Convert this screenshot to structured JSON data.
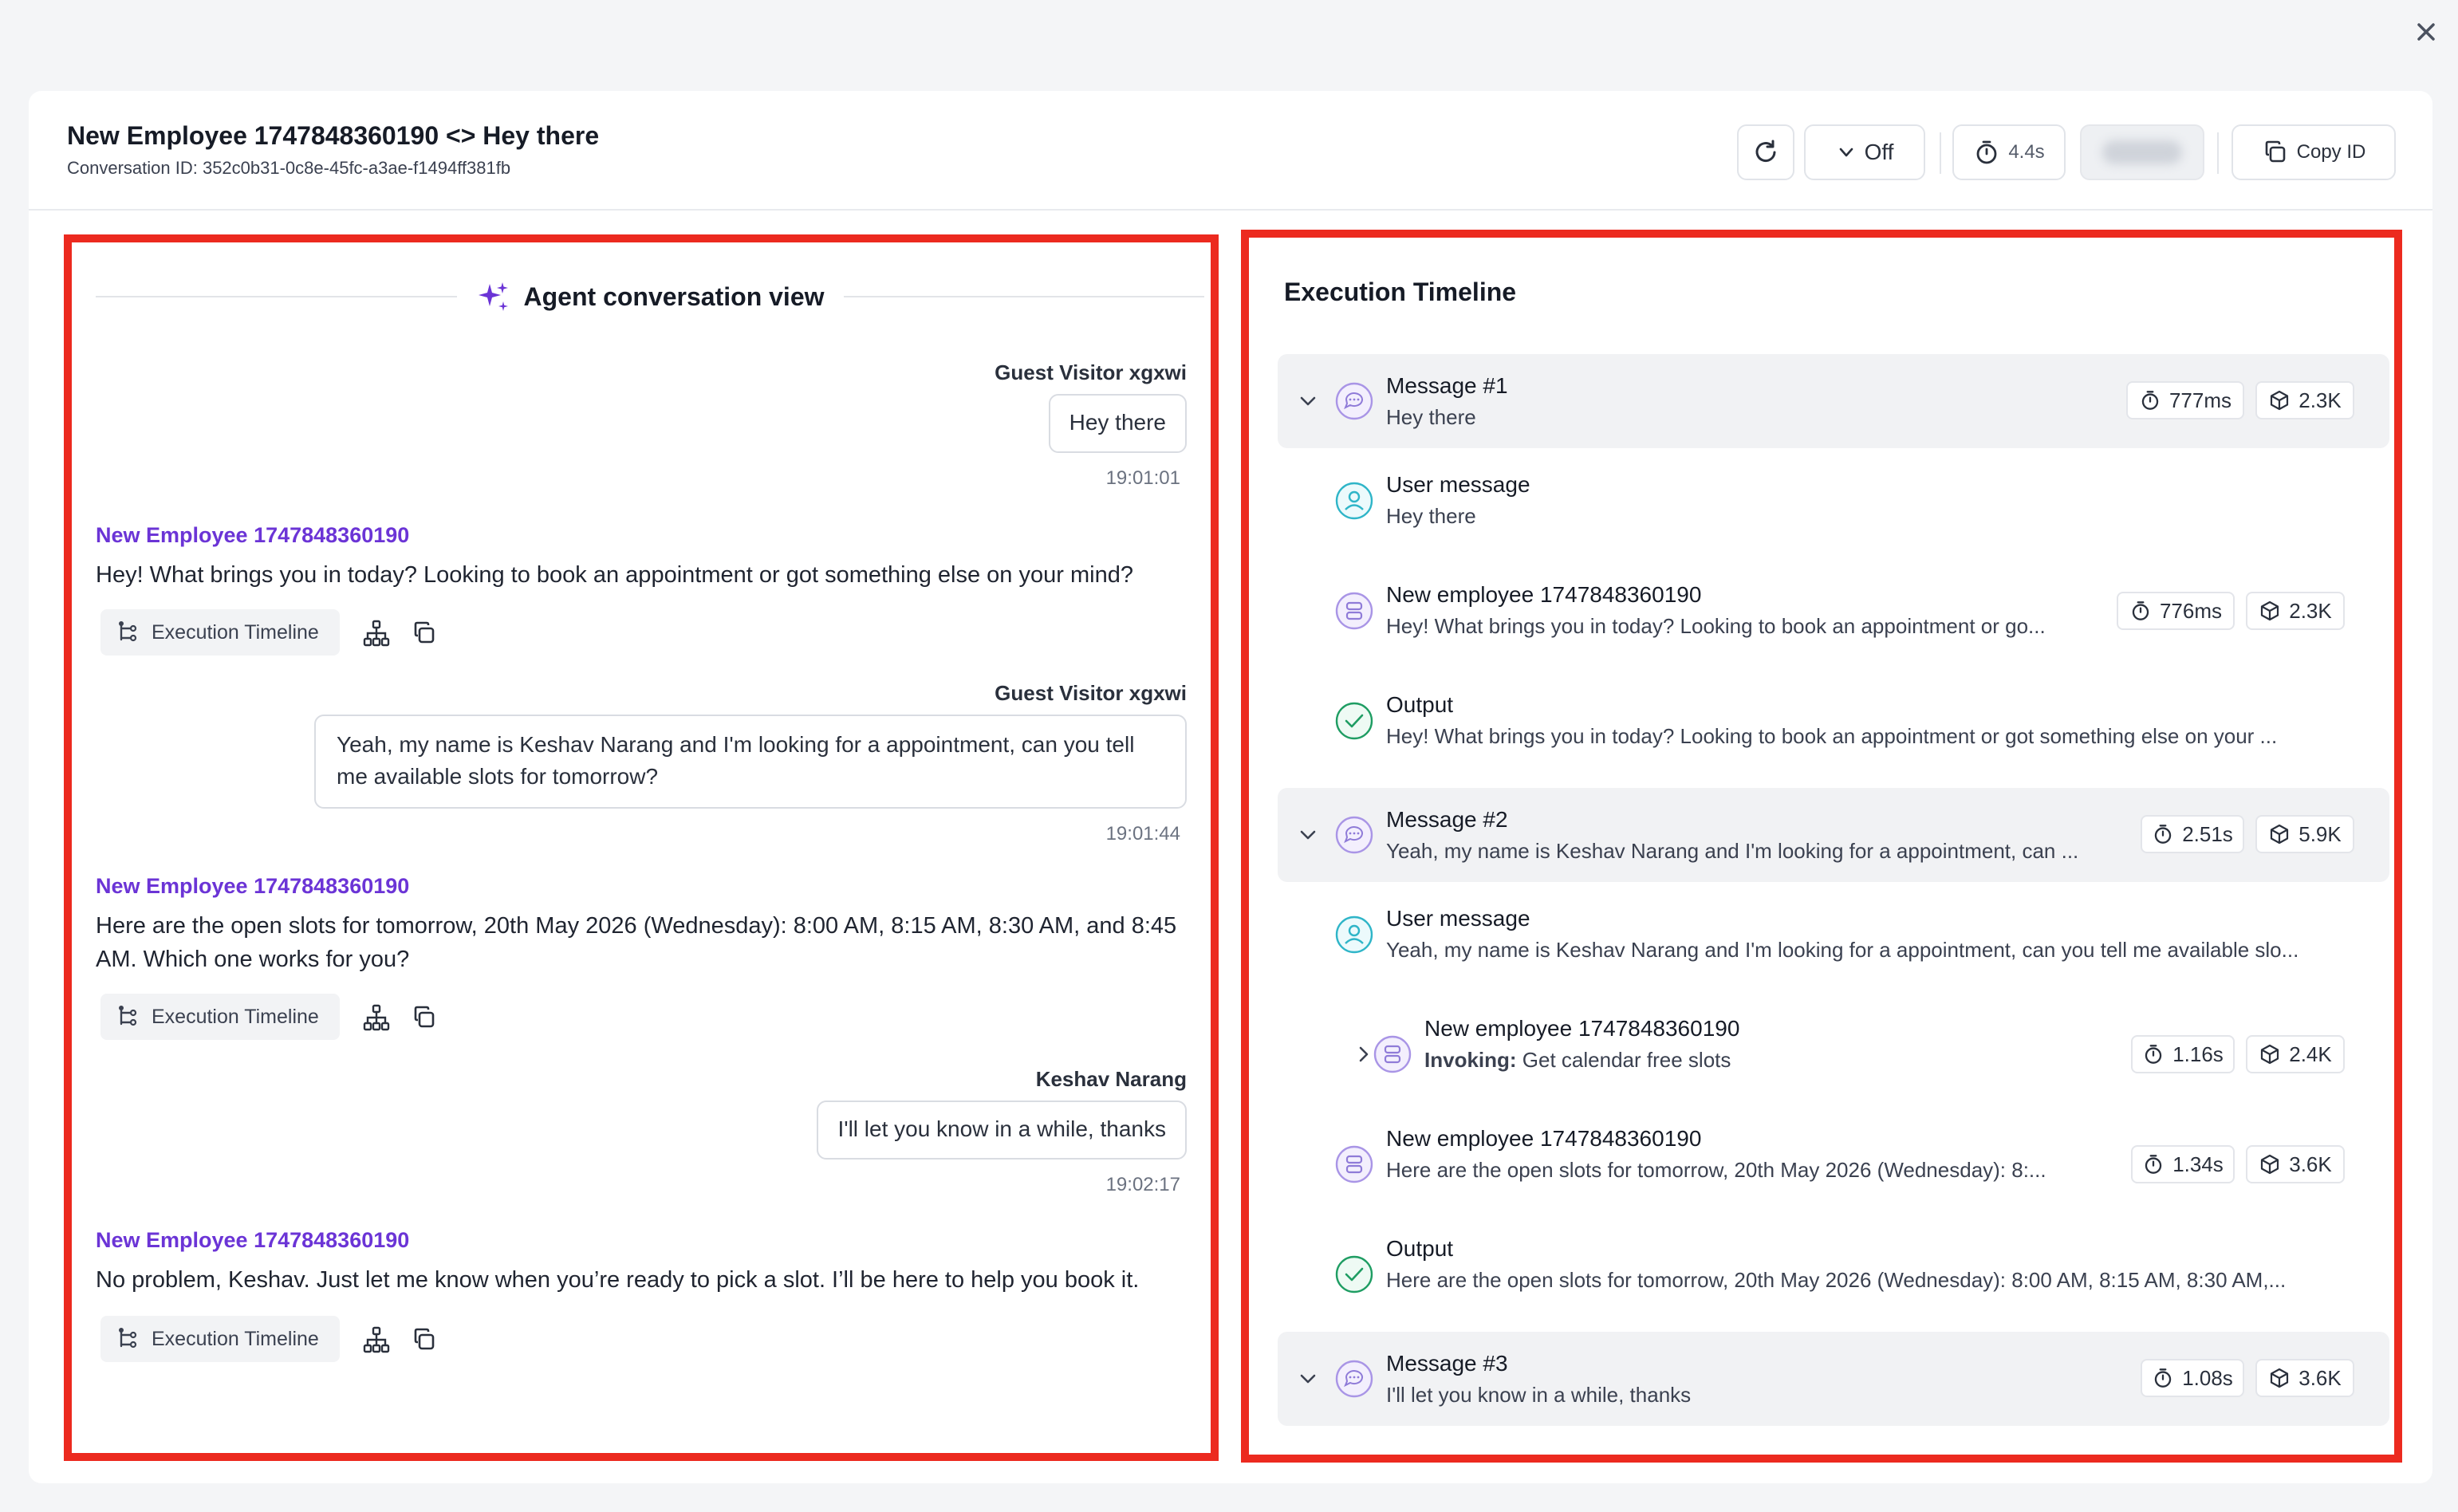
{
  "modal": {
    "title": "New Employee 1747848360190 <> Hey there",
    "conversation_id": "Conversation ID: 352c0b31-0c8e-45fc-a3ae-f1494ff381fb",
    "toggle_label": "Off",
    "timer_label": "4.4s",
    "copy_label": "Copy ID"
  },
  "conversation": {
    "heading": "Agent conversation view",
    "exec_label": "Execution Timeline",
    "messages": [
      {
        "sender": "Guest Visitor xgxwi",
        "text": "Hey there",
        "time": "19:01:01"
      },
      {
        "agent": "New Employee 1747848360190",
        "text": "Hey! What brings you in today? Looking to book an appointment or got something else on your mind?"
      },
      {
        "sender": "Guest Visitor xgxwi",
        "text": "Yeah, my name is Keshav Narang and I'm looking for a appointment, can you tell me available slots for tomorrow?",
        "time": "19:01:44"
      },
      {
        "agent": "New Employee 1747848360190",
        "text": "Here are the open slots for tomorrow, 20th May 2026 (Wednesday): 8:00 AM, 8:15 AM, 8:30 AM, and 8:45 AM. Which one works for you?"
      },
      {
        "sender": "Keshav Narang",
        "text": "I'll let you know in a while, thanks",
        "time": "19:02:17"
      },
      {
        "agent": "New Employee 1747848360190",
        "text": "No problem, Keshav. Just let me know when you’re ready to pick a slot. I’ll be here to help you book it."
      }
    ]
  },
  "timeline": {
    "title": "Execution Timeline",
    "messages": [
      {
        "title": "Message #1",
        "subtitle": "Hey there",
        "time": "777ms",
        "tokens": "2.3K",
        "steps": [
          {
            "type": "user",
            "title": "User message",
            "subtitle": "Hey there"
          },
          {
            "type": "agent",
            "title": "New employee 1747848360190",
            "subtitle": "Hey! What brings you in today? Looking to book an appointment or go...",
            "time": "776ms",
            "tokens": "2.3K"
          },
          {
            "type": "output",
            "title": "Output",
            "subtitle": "Hey! What brings you in today? Looking to book an appointment or got something else on your ..."
          }
        ]
      },
      {
        "title": "Message #2",
        "subtitle": "Yeah, my name is Keshav Narang and I'm looking for a appointment, can ...",
        "time": "2.51s",
        "tokens": "5.9K",
        "steps": [
          {
            "type": "user",
            "title": "User message",
            "subtitle": "Yeah, my name is Keshav Narang and I'm looking for a appointment, can you tell me available slo..."
          },
          {
            "type": "agent",
            "title": "New employee 1747848360190",
            "subtitle_prefix": "Invoking:",
            "subtitle": "Get calendar free slots",
            "time": "1.16s",
            "tokens": "2.4K"
          },
          {
            "type": "agent",
            "title": "New employee 1747848360190",
            "subtitle": "Here are the open slots for tomorrow, 20th May 2026 (Wednesday): 8:...",
            "time": "1.34s",
            "tokens": "3.6K"
          },
          {
            "type": "output",
            "title": "Output",
            "subtitle": "Here are the open slots for tomorrow, 20th May 2026 (Wednesday): 8:00 AM, 8:15 AM, 8:30 AM,..."
          }
        ]
      },
      {
        "title": "Message #3",
        "subtitle": "I'll let you know in a while, thanks",
        "time": "1.08s",
        "tokens": "3.6K"
      }
    ]
  },
  "colors": {
    "accent": "#6b34d6",
    "highlight": "#ec2a1f",
    "user_icon": "#2fb5c8",
    "agent_icon": "#8f7bd8",
    "output_icon": "#1f9d63"
  }
}
